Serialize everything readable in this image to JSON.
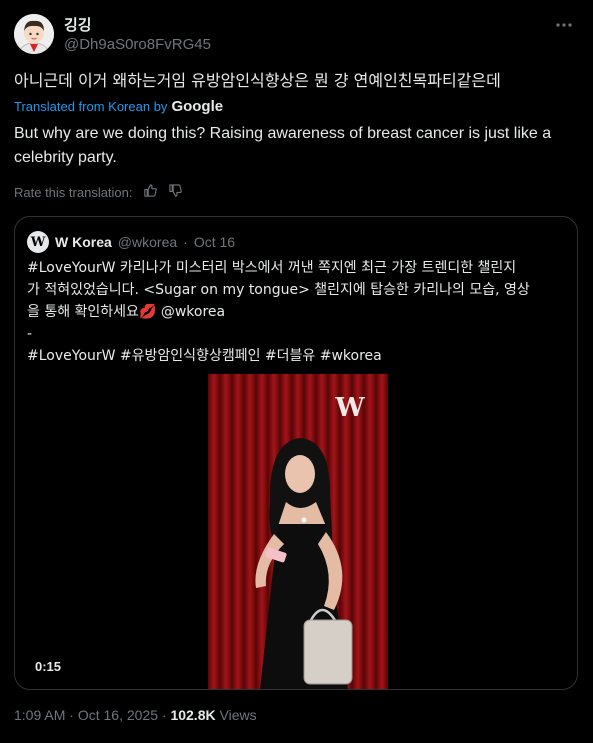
{
  "author": {
    "name": "깅깅",
    "handle": "@Dh9aS0ro8FvRG45"
  },
  "more_icon": "more-horizontal-icon",
  "post": {
    "original_text": "아니근데 이거 왜하는거임 유방암인식향상은 뭔 걍 연예인친목파티같은데",
    "translated_from": "Translated from Korean by",
    "translator": "Google",
    "translation": "But why are we doing this? Raising awareness of breast cancer is just like a celebrity party.",
    "rate_label": "Rate this translation:"
  },
  "quote": {
    "name": "W Korea",
    "handle": "@wkorea",
    "date": "Oct 16",
    "logo_letter": "W",
    "lines": [
      "#LoveYourW 카리나가 미스터리 박스에서 꺼낸 쪽지엔 최근 가장 트렌디한 챌린지",
      "가 적혀있었습니다. <Sugar on my tongue> 챌린지에 탑승한 카리나의 모습, 영상",
      "을 통해 확인하세요💋 @wkorea",
      "-",
      "#LoveYourW #유방암인식향상캠페인 #더블유 #wkorea"
    ],
    "video_duration": "0:15",
    "video_logo": "W"
  },
  "footer": {
    "time": "1:09 AM",
    "date": "Oct 16, 2025",
    "views_count": "102.8K",
    "views_label": "Views"
  },
  "colors": {
    "accent": "#1d9bf0",
    "muted": "#71767b",
    "text": "#e7e9ea",
    "border": "#2f3336"
  }
}
